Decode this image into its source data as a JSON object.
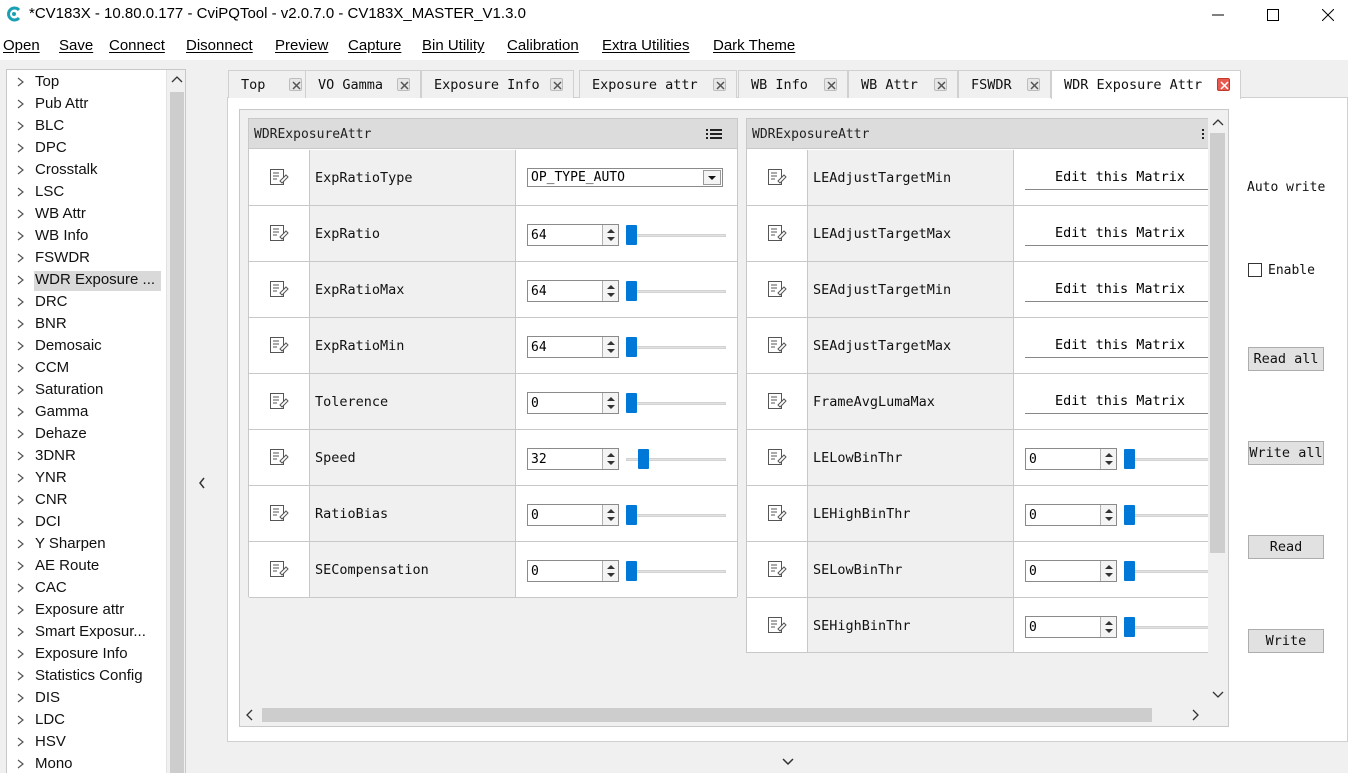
{
  "window": {
    "title": "*CV183X - 10.80.0.177 - CviPQTool - v2.0.7.0 - CV183X_MASTER_V1.3.0",
    "brand_color": "#1aa0b4"
  },
  "menu": [
    "Open",
    "Save",
    "Connect",
    "Disonnect",
    "Preview",
    "Capture",
    "Bin Utility",
    "Calibration",
    "Extra Utilities",
    "Dark Theme"
  ],
  "sidebar": {
    "selected": "WDR Exposure ...",
    "items": [
      "Top",
      "Pub Attr",
      "BLC",
      "DPC",
      "Crosstalk",
      "LSC",
      "WB Attr",
      "WB Info",
      "FSWDR",
      "WDR Exposure ...",
      "DRC",
      "BNR",
      "Demosaic",
      "CCM",
      "Saturation",
      "Gamma",
      "Dehaze",
      "3DNR",
      "YNR",
      "CNR",
      "DCI",
      "Y Sharpen",
      "AE Route",
      "CAC",
      "Exposure attr",
      "Smart Exposur...",
      "Exposure Info",
      "Statistics Config",
      "DIS",
      "LDC",
      "HSV",
      "Mono"
    ]
  },
  "tabs": {
    "active": "WDR Exposure Attr",
    "items": [
      "Top",
      "VO Gamma",
      "Exposure Info",
      "Exposure attr",
      "WB Info",
      "WB Attr",
      "FSWDR",
      "WDR Exposure Attr"
    ]
  },
  "left_panel": {
    "title": "WDRExposureAttr",
    "rows": [
      {
        "name": "ExpRatioType",
        "type": "combo",
        "value": "OP_TYPE_AUTO"
      },
      {
        "name": "ExpRatio",
        "type": "spin",
        "value": "64",
        "level": 0.0
      },
      {
        "name": "ExpRatioMax",
        "type": "spin",
        "value": "64",
        "level": 0.0
      },
      {
        "name": "ExpRatioMin",
        "type": "spin",
        "value": "64",
        "level": 0.0
      },
      {
        "name": "Tolerence",
        "type": "spin",
        "value": "0",
        "level": 0.0
      },
      {
        "name": "Speed",
        "type": "spin",
        "value": "32",
        "level": 0.13
      },
      {
        "name": "RatioBias",
        "type": "spin",
        "value": "0",
        "level": 0.0
      },
      {
        "name": "SECompensation",
        "type": "spin",
        "value": "0",
        "level": 0.0
      }
    ]
  },
  "right_panel": {
    "title": "WDRExposureAttr",
    "rows": [
      {
        "name": "LEAdjustTargetMin",
        "type": "matrix",
        "value": "Edit this Matrix"
      },
      {
        "name": "LEAdjustTargetMax",
        "type": "matrix",
        "value": "Edit this Matrix"
      },
      {
        "name": "SEAdjustTargetMin",
        "type": "matrix",
        "value": "Edit this Matrix"
      },
      {
        "name": "SEAdjustTargetMax",
        "type": "matrix",
        "value": "Edit this Matrix"
      },
      {
        "name": "FrameAvgLumaMax",
        "type": "matrix",
        "value": "Edit this Matrix"
      },
      {
        "name": "LELowBinThr",
        "type": "spin",
        "value": "0",
        "level": 0.0
      },
      {
        "name": "LEHighBinThr",
        "type": "spin",
        "value": "0",
        "level": 0.0
      },
      {
        "name": "SELowBinThr",
        "type": "spin",
        "value": "0",
        "level": 0.0
      },
      {
        "name": "SEHighBinThr",
        "type": "spin",
        "value": "0",
        "level": 0.0
      }
    ]
  },
  "side_controls": {
    "auto_write_label": "Auto write",
    "enable_label": "Enable",
    "enable_checked": false,
    "read_all": "Read all",
    "write_all": "Write all",
    "read": "Read",
    "write": "Write"
  },
  "accent_color": "#0078d7"
}
